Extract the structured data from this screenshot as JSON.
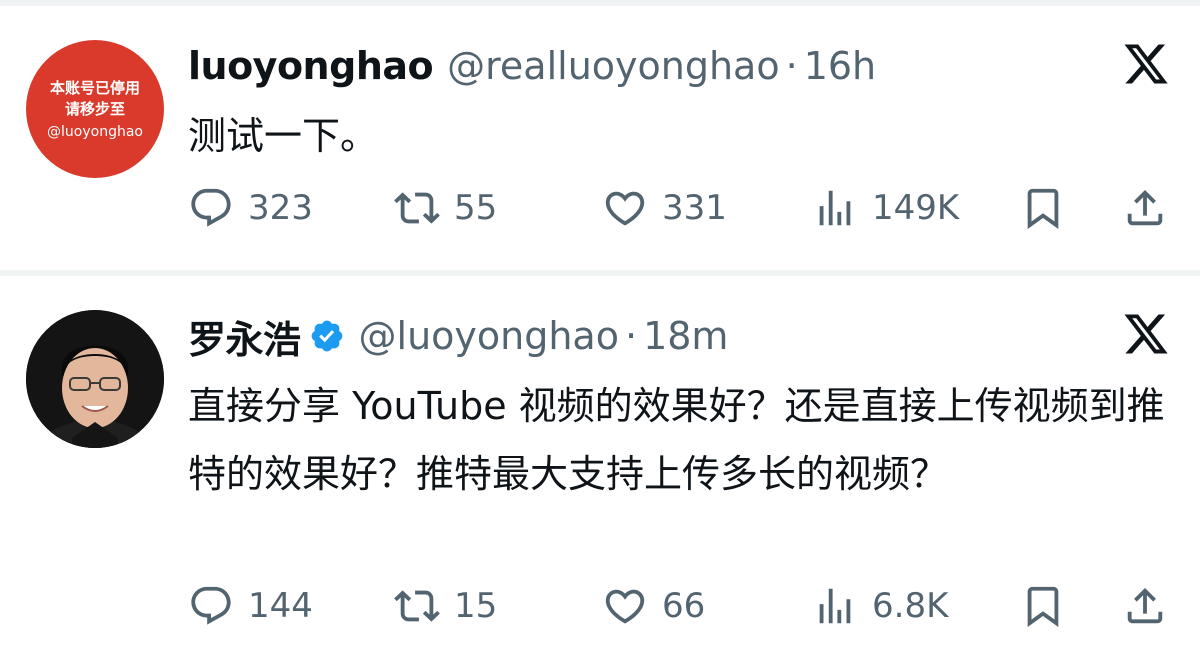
{
  "tweets": [
    {
      "avatar_text": [
        "本账号已停用",
        "请移步至",
        "@luoyonghao"
      ],
      "avatar_color": "#d93a2b",
      "name": "luoyonghao",
      "verified": false,
      "handle": "@realluoyonghao",
      "separator": "·",
      "time": "16h",
      "text": "测试一下。",
      "actions": {
        "replies": "323",
        "reposts": "55",
        "likes": "331",
        "views": "149K"
      }
    },
    {
      "avatar_text": [],
      "name": "罗永浩",
      "verified": true,
      "handle": "@luoyonghao",
      "separator": "·",
      "time": "18m",
      "text": "直接分享 YouTube 视频的效果好？还是直接上传视频到推特的效果好？推特最大支持上传多长的视频？",
      "actions": {
        "replies": "144",
        "reposts": "15",
        "likes": "66",
        "views": "6.8K"
      }
    }
  ],
  "icons": {
    "brand": "x-logo-icon",
    "reply": "reply-icon",
    "repost": "repost-icon",
    "like": "heart-icon",
    "views": "views-icon",
    "bookmark": "bookmark-icon",
    "share": "share-icon",
    "verified": "verified-badge-icon"
  },
  "colors": {
    "text": "#0f1419",
    "secondary": "#536471",
    "verified": "#1d9bf0",
    "divider": "#eff3f4"
  }
}
